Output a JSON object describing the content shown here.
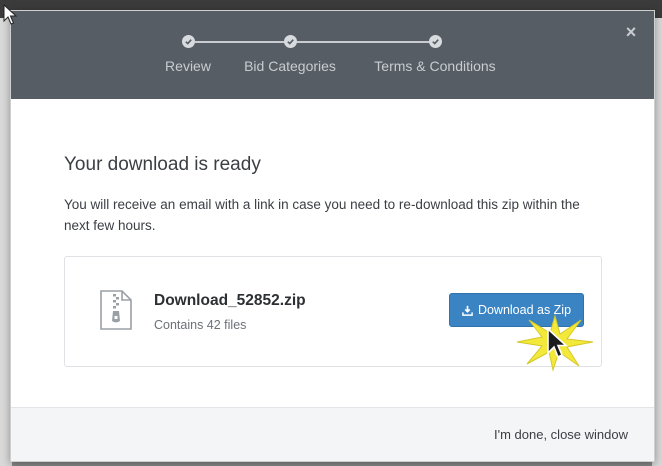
{
  "dialog": {
    "close_glyph": "×",
    "steps": [
      {
        "label": "Review",
        "completed": true
      },
      {
        "label": "Bid Categories",
        "completed": true
      },
      {
        "label": "Terms & Conditions",
        "completed": true
      }
    ],
    "title": "Your download is ready",
    "description": "You will receive an email with a link in case you need to re-download this zip within the next few hours.",
    "file": {
      "icon": "zip-file-icon",
      "name": "Download_52852.zip",
      "summary": "Contains 42 files"
    },
    "download_button": {
      "icon": "download-icon",
      "label": "Download as Zip"
    },
    "footer": {
      "done_label": "I'm done, close window"
    }
  },
  "colors": {
    "header_bg": "#575d65",
    "primary_button": "#3a84c4",
    "footer_bg": "#f4f5f7",
    "click_highlight": "#f2e93a"
  }
}
